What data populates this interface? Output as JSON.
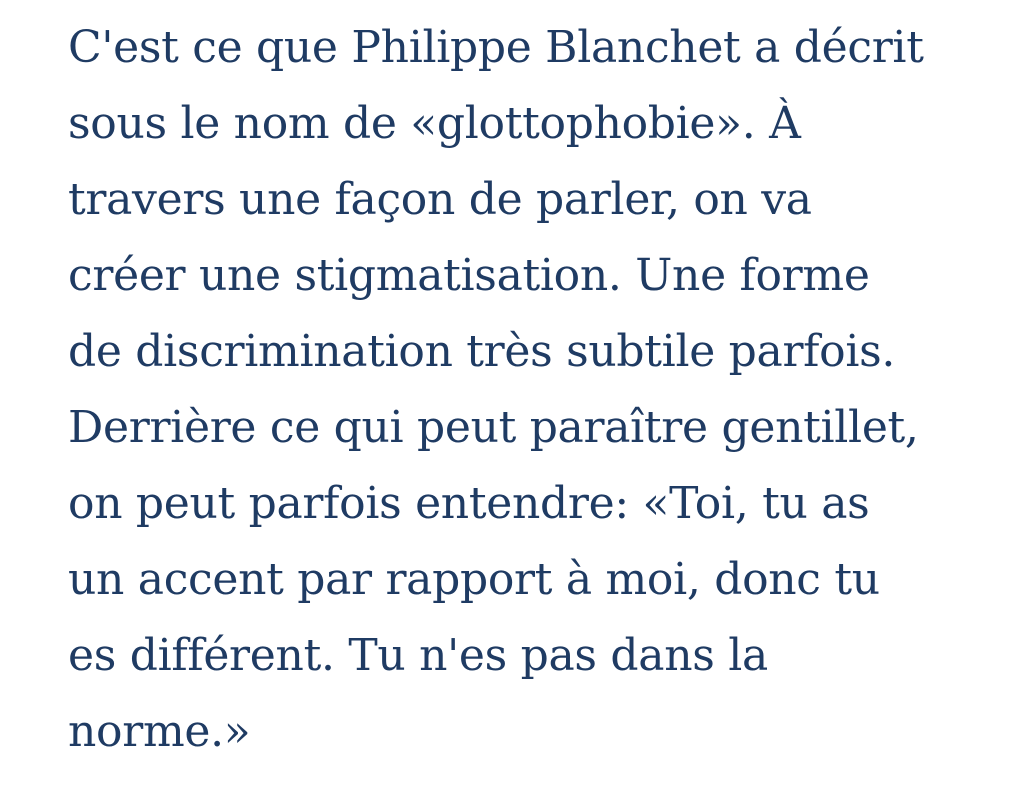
{
  "article": {
    "lines": [
      "C'est ce que Philippe Blanchet a décrit",
      "sous le nom de «glottophobie». À",
      "travers une façon de parler, on va",
      "créer une stigmatisation. Une forme",
      "de discrimination très subtile parfois.",
      "Derrière ce qui peut paraître gentillet,",
      "on peut parfois entendre: «Toi, tu as",
      "un accent par rapport à moi, donc tu",
      "es différent. Tu n'es pas dans la",
      "norme.»"
    ]
  },
  "colors": {
    "text": "#1f3b63",
    "background": "#ffffff"
  }
}
